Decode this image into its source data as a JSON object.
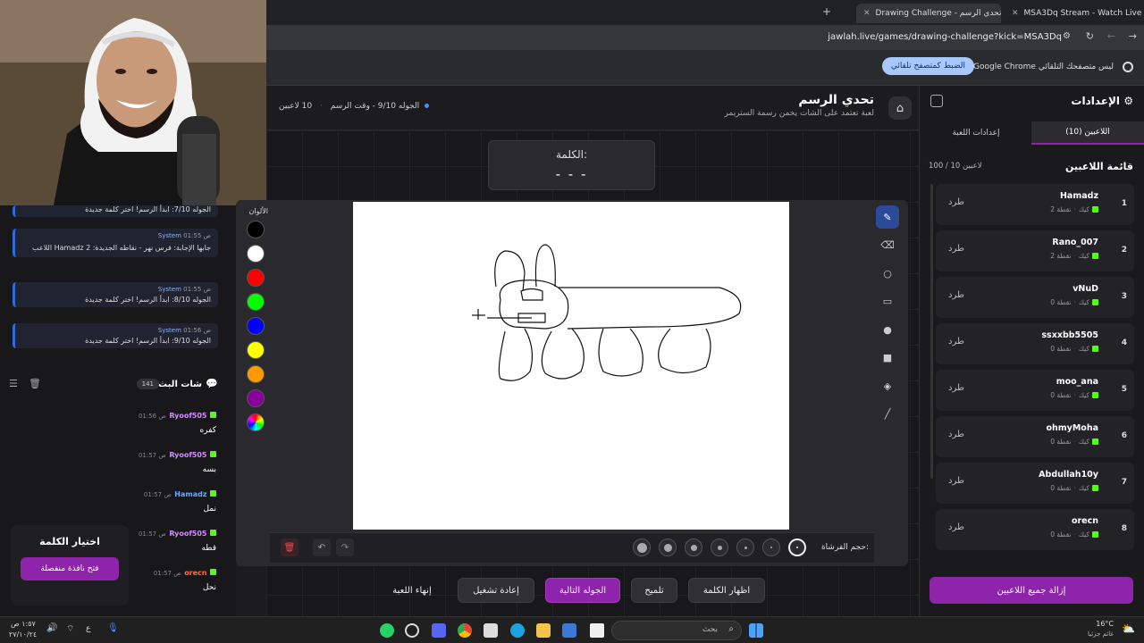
{
  "browser": {
    "tabs": [
      {
        "label": "Drawing Challenge - تحدي الرسم",
        "active": true
      },
      {
        "label": "MSA3Dq Stream - Watch Live o...",
        "active": false
      }
    ],
    "url": "jawlah.live/games/drawing-challenge?kick=MSA3Dq",
    "infobar": {
      "message": "Google Chrome ليس متصفحك التلقائي",
      "button": "الضبط كمتصفح تلقائي"
    }
  },
  "game": {
    "title": "تحدي الرسم",
    "subtitle": "لعبة تعتمد على الشات يخمن رسمة الستريمر",
    "round_info": "الجوله 9/10 - وقت الرسم",
    "players_info": "10 لاعبين",
    "word_label": "الكلمة:",
    "word_value": "- - -",
    "colors_label": "الألوان",
    "brush_label": "حجم الفرشاة:",
    "colors": [
      "#000000",
      "#ffffff",
      "#ff0000",
      "#00ff00",
      "#0000ff",
      "#ffff00",
      "#ff9900",
      "#880099"
    ],
    "tools": [
      "pencil-icon",
      "eraser-icon",
      "circle-icon",
      "rect-icon",
      "fill-circle-icon",
      "fill-rect-icon",
      "bucket-icon",
      "line-icon"
    ],
    "controls": {
      "end": "إنهاء اللعبة",
      "restart": "إعادة تشغيل",
      "next": "الجوله التالية",
      "hint": "تلميح",
      "show_word": "اظهار الكلمة"
    }
  },
  "settings": {
    "title": "الإعدادات",
    "tab_players": "اللاعبين (10)",
    "tab_game": "إعدادات اللعبة",
    "list_title": "قائمة اللاعبين",
    "count": "100 / 10 لاعبين",
    "kick_label": "طرد",
    "remove_all": "إزالة جميع اللاعبين",
    "players": [
      {
        "rank": "1",
        "name": "Hamadz",
        "platform": "كيك",
        "points": "2 نقطة"
      },
      {
        "rank": "2",
        "name": "Rano_007",
        "platform": "كيك",
        "points": "2 نقطة"
      },
      {
        "rank": "3",
        "name": "vNuD",
        "platform": "كيك",
        "points": "0 نقطة"
      },
      {
        "rank": "4",
        "name": "ssxxbb5505",
        "platform": "كيك",
        "points": "0 نقطة"
      },
      {
        "rank": "5",
        "name": "moo_ana",
        "platform": "كيك",
        "points": "0 نقطة"
      },
      {
        "rank": "6",
        "name": "ohmyMoha",
        "platform": "كيك",
        "points": "0 نقطة"
      },
      {
        "rank": "7",
        "name": "Abdullah10y",
        "platform": "كيك",
        "points": "0 نقطة"
      },
      {
        "rank": "8",
        "name": "orecn",
        "platform": "كيك",
        "points": "0 نقطة"
      }
    ]
  },
  "system_messages": [
    {
      "top": "",
      "text": "الجوله 7/10: ابدأ الرسم! اختر كلمة جديدة"
    },
    {
      "sender": "System",
      "time": "01:55 ص",
      "text": "اللاعب Hamadz جابها الإجابة: فرس نهر - نقاطه الجديدة: 2"
    },
    {
      "sender": "System",
      "time": "01:55 ص",
      "text": "الجوله 8/10: ابدأ الرسم! اختر كلمة جديدة"
    },
    {
      "sender": "System",
      "time": "01:56 ص",
      "text": "الجوله 9/10: ابدأ الرسم! اختر كلمة جديدة"
    }
  ],
  "chat": {
    "title": "شات البث",
    "count": "141",
    "messages": [
      {
        "user": "Ryoof505",
        "time": "01:56 ص",
        "text": "كفره"
      },
      {
        "user": "Ryoof505",
        "time": "01:57 ص",
        "text": "بسه"
      },
      {
        "user": "Hamadz",
        "time": "01:57 ص",
        "text": "نمل"
      },
      {
        "user": "Ryoof505",
        "time": "01:57 ص",
        "text": "قطه"
      },
      {
        "user": "orecn",
        "time": "01:57 ص",
        "text": "نحل"
      }
    ]
  },
  "choose_word": {
    "title": "اختيار الكلمة",
    "button": "فتح نافذة منفصلة"
  },
  "taskbar": {
    "search": "بحث",
    "weather": "16°C",
    "weather_desc": "غائم جزئيا",
    "time": "١:٥٧ ص",
    "date": "٢٧/١٠/٢٤",
    "lang": "ع"
  }
}
